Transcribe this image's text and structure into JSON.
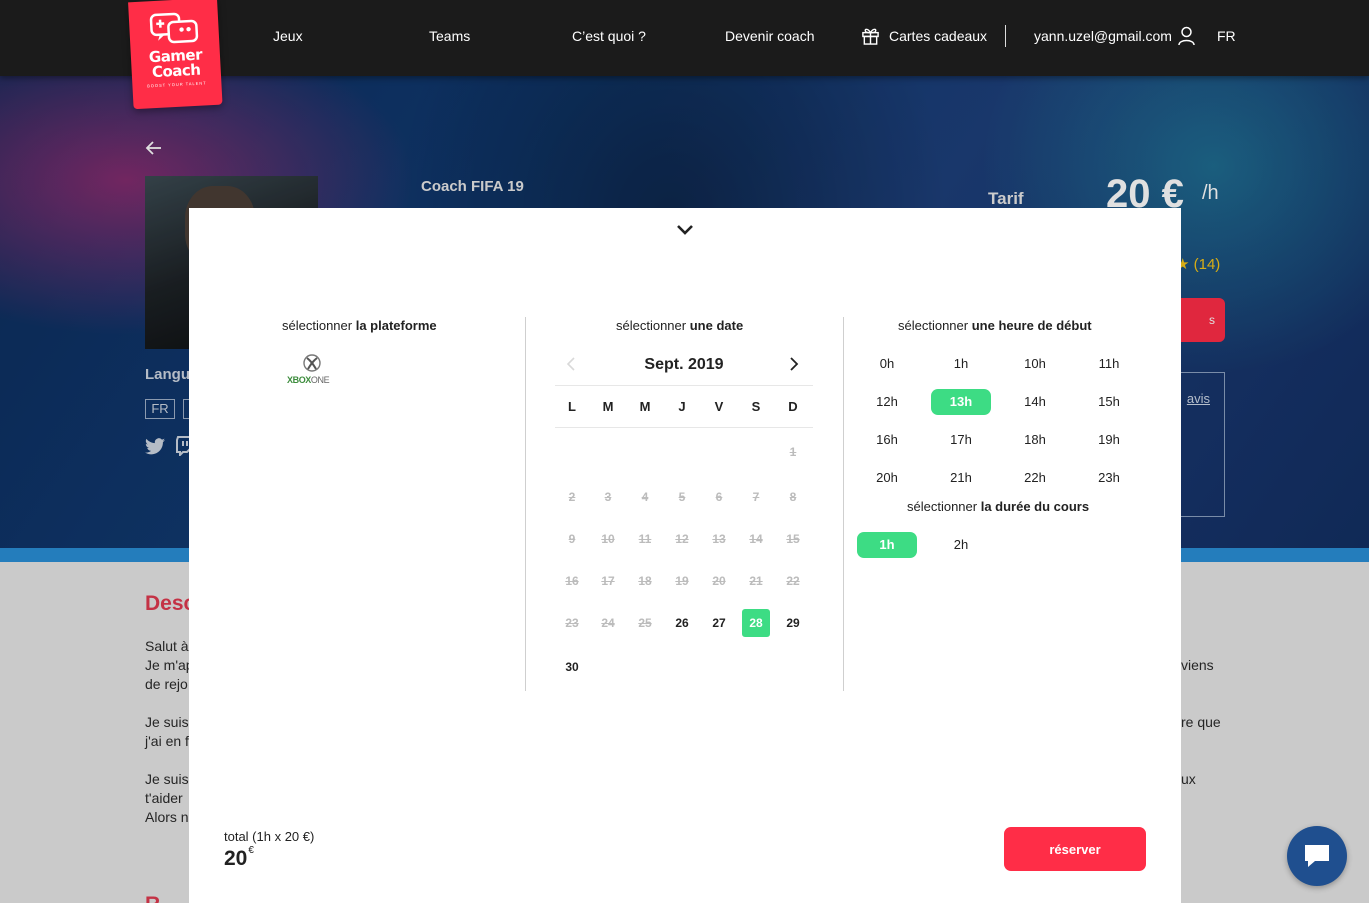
{
  "nav": {
    "links": [
      "Jeux",
      "Teams",
      "C’est quoi ?",
      "Devenir coach"
    ],
    "gift_label": "Cartes cadeaux",
    "user_email": "yann.uzel@gmail.com",
    "lang": "FR"
  },
  "logo": {
    "line1": "Gamer",
    "line2": "Coach",
    "tagline": "BOOST YOUR TALENT"
  },
  "hero": {
    "coach_title": "Coach FIFA 19",
    "tarif_label": "Tarif",
    "price": "20 €",
    "price_unit": "/h",
    "rating_count": "★ (14)",
    "book_btn_partial": "s",
    "reviews_link_partial": "avis",
    "languages_label_partial": "Langu",
    "language_badge": "FR"
  },
  "description": {
    "title_partial": "Desc",
    "lines_left": [
      "Salut à",
      "Je m'ap",
      "de rejo",
      "Je suis",
      "j'ai en f",
      "Je suis",
      "t'aider",
      "Alors n"
    ],
    "lines_right": [
      "viens",
      "re que",
      "ux"
    ],
    "bottom_title_partial": "R"
  },
  "modal": {
    "platform": {
      "title_prefix": "sélectionner ",
      "title_bold": "la plateforme",
      "options": [
        {
          "name": "XBOX",
          "suffix": "ONE"
        }
      ]
    },
    "date": {
      "title_prefix": "sélectionner ",
      "title_bold": "une date",
      "month_label": "Sept. 2019",
      "weekdays": [
        "L",
        "M",
        "M",
        "J",
        "V",
        "S",
        "D"
      ],
      "first_weekday_index": 6,
      "days_in_month": 30,
      "available_days": [
        26,
        27,
        28,
        29,
        30
      ],
      "selected_day": 28
    },
    "start_time": {
      "title_prefix": "sélectionner ",
      "title_bold": "une heure de début",
      "slots": [
        "0h",
        "1h",
        "10h",
        "11h",
        "12h",
        "13h",
        "14h",
        "15h",
        "16h",
        "17h",
        "18h",
        "19h",
        "20h",
        "21h",
        "22h",
        "23h"
      ],
      "selected": "13h"
    },
    "duration": {
      "title_prefix": "sélectionner ",
      "title_bold": "la durée du cours",
      "options": [
        "1h",
        "2h"
      ],
      "selected": "1h"
    },
    "total_label": "total (1h x 20 €)",
    "total_value": "20",
    "total_currency": "€",
    "reserve_label": "réserver"
  },
  "colors": {
    "accent_red": "#ff2d47",
    "selected_green": "#3ddc84",
    "nav_bg": "#1b1b1b",
    "chat_blue": "#1f4f8f"
  }
}
